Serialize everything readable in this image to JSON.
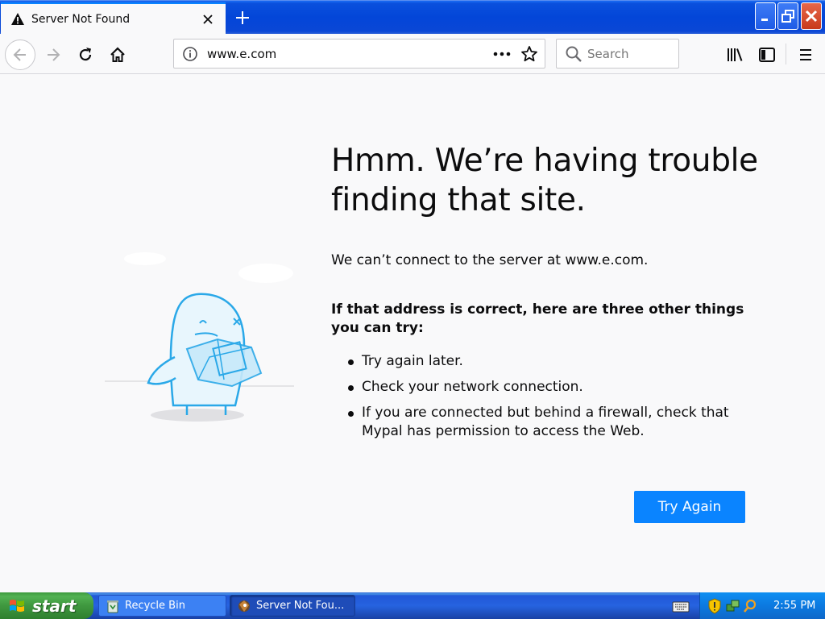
{
  "tab": {
    "title": "Server Not Found"
  },
  "navbar": {
    "url": "www.e.com",
    "search_placeholder": "Search"
  },
  "error": {
    "title": "Hmm. We’re having trouble finding that site.",
    "description": "We can’t connect to the server at www.e.com.",
    "subtitle": "If that address is correct, here are three other things you can try:",
    "tips": [
      "Try again later.",
      "Check your network connection.",
      "If you are connected but behind a firewall, check that Mypal has permission to access the Web."
    ],
    "button_label": "Try Again"
  },
  "taskbar": {
    "start_label": "start",
    "items": [
      {
        "label": "Recycle Bin"
      },
      {
        "label": "Server Not Fou..."
      }
    ],
    "clock": "2:55 PM"
  },
  "colors": {
    "accent": "#0a84ff",
    "xp_blue": "#0346d8",
    "xp_green": "#3f983f",
    "illustration": "#2aa8e8"
  },
  "icons": [
    "warning-icon",
    "close-icon",
    "plus-icon",
    "back-icon",
    "forward-icon",
    "reload-icon",
    "home-icon",
    "info-icon",
    "more-icon",
    "star-icon",
    "search-icon",
    "library-icon",
    "sidebar-icon",
    "menu-icon",
    "windows-logo-icon",
    "recycle-bin-icon",
    "browser-icon",
    "keyboard-icon",
    "security-shield-icon"
  ]
}
